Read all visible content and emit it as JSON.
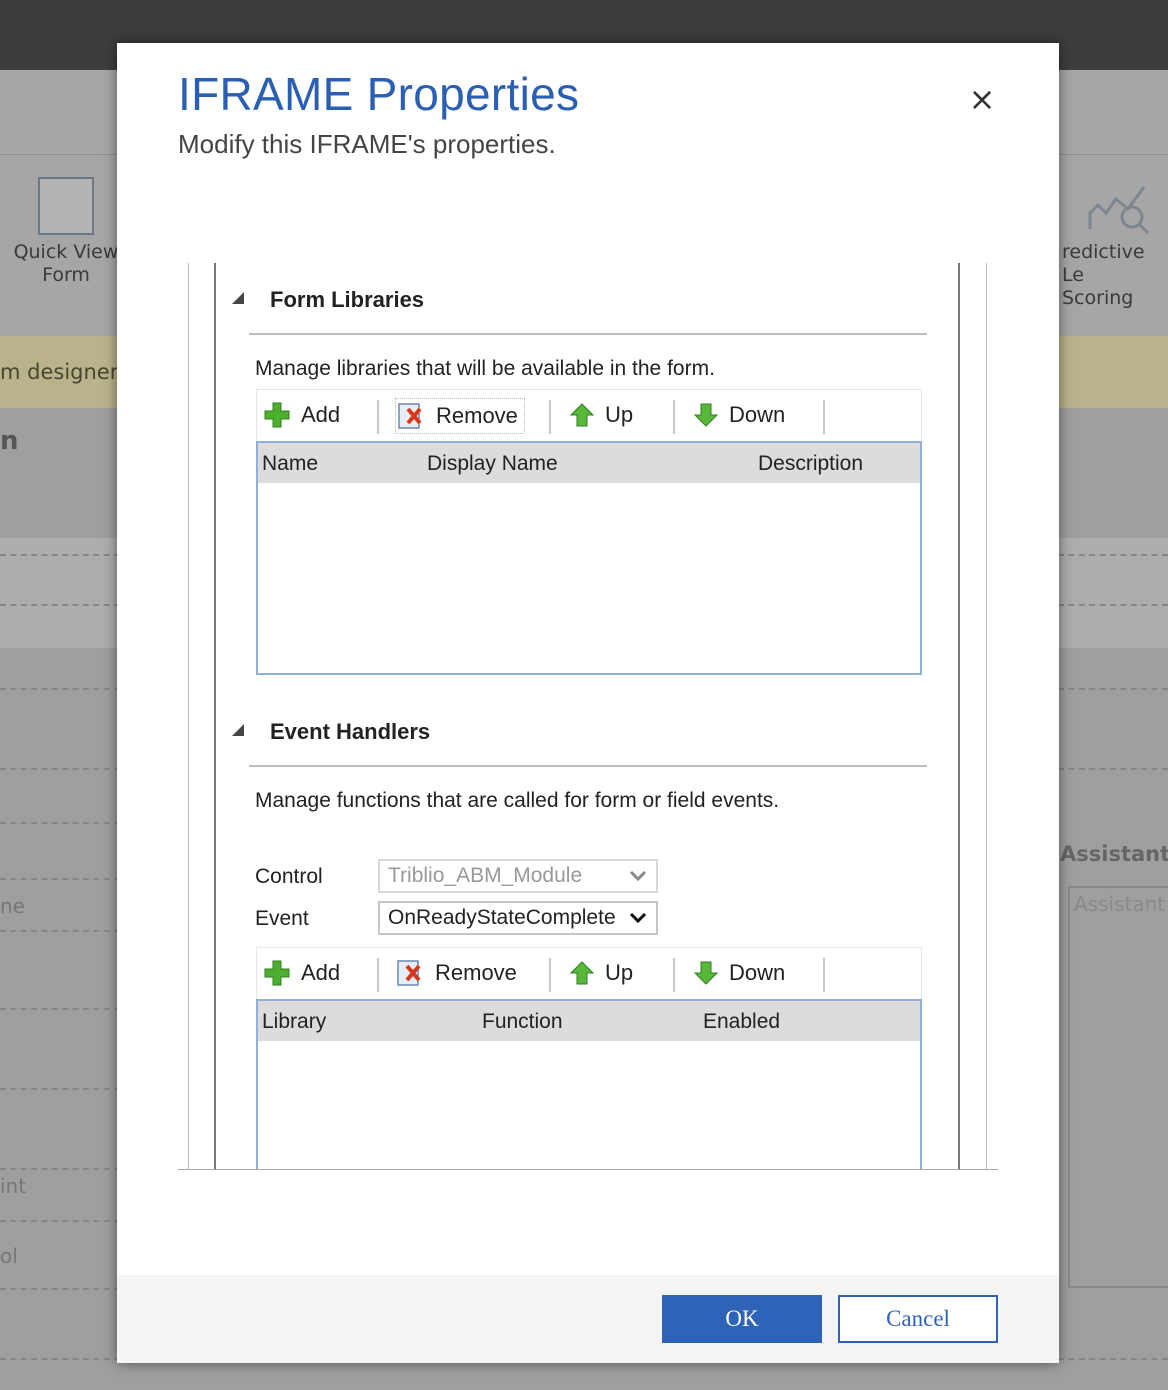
{
  "background": {
    "ribbon_left_label": "Quick View\nForm",
    "ribbon_right_label": "redictive Le\nScoring",
    "notice_text": "m designer t",
    "heading_fragment": "n",
    "assistant_label": "Assistant",
    "assistant_placeholder": "Assistant",
    "field_fragments": [
      "ne",
      "int",
      "ol"
    ]
  },
  "dialog": {
    "title": "IFRAME Properties",
    "subtitle": "Modify this IFRAME's properties.",
    "close_label": "×",
    "form_libraries": {
      "heading": "Form Libraries",
      "description": "Manage libraries that will be available in the form.",
      "toolbar": {
        "add": "Add",
        "remove": "Remove",
        "up": "Up",
        "down": "Down"
      },
      "columns": [
        "Name",
        "Display Name",
        "Description"
      ]
    },
    "event_handlers": {
      "heading": "Event Handlers",
      "description": "Manage functions that are called for form or field events.",
      "control_label": "Control",
      "control_value": "Triblio_ABM_Module",
      "event_label": "Event",
      "event_value": "OnReadyStateComplete",
      "toolbar": {
        "add": "Add",
        "remove": "Remove",
        "up": "Up",
        "down": "Down"
      },
      "columns": [
        "Library",
        "Function",
        "Enabled"
      ]
    },
    "ok_label": "OK",
    "cancel_label": "Cancel"
  },
  "colors": {
    "accent": "#2e63b8",
    "title": "#2b5fb4",
    "grid_border": "#8fb0d8",
    "add_green": "#4caf2e"
  }
}
